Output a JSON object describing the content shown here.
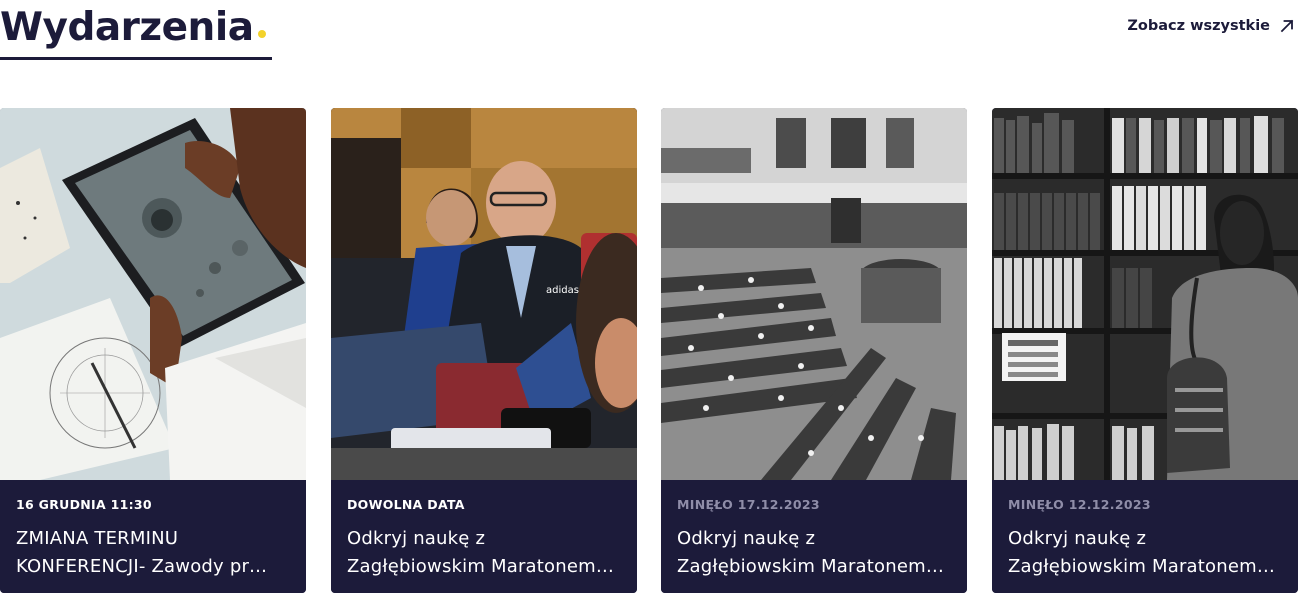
{
  "section": {
    "title": "Wydarzenia",
    "see_all_label": "Zobacz wszystkie",
    "accent_color": "#f3d22b",
    "navy_color": "#1c1b3a"
  },
  "events": [
    {
      "date": "16 GRUDNIA 11:30",
      "title": "ZMIANA TERMINU KONFERENCJI- Zawody pr…",
      "image": "child-with-tablet-moon-photo",
      "past": false
    },
    {
      "date": "DOWOLNA DATA",
      "title": "Odkryj naukę z Zagłębiowskim Maratonem…",
      "image": "audience-at-lecture",
      "past": false
    },
    {
      "date": "MINĘŁO 17.12.2023",
      "title": "Odkryj naukę z Zagłębiowskim Maratonem…",
      "image": "library-reading-room",
      "past": true
    },
    {
      "date": "MINĘŁO 12.12.2023",
      "title": "Odkryj naukę z Zagłębiowskim Maratonem…",
      "image": "person-at-bookshelves",
      "past": true
    }
  ]
}
